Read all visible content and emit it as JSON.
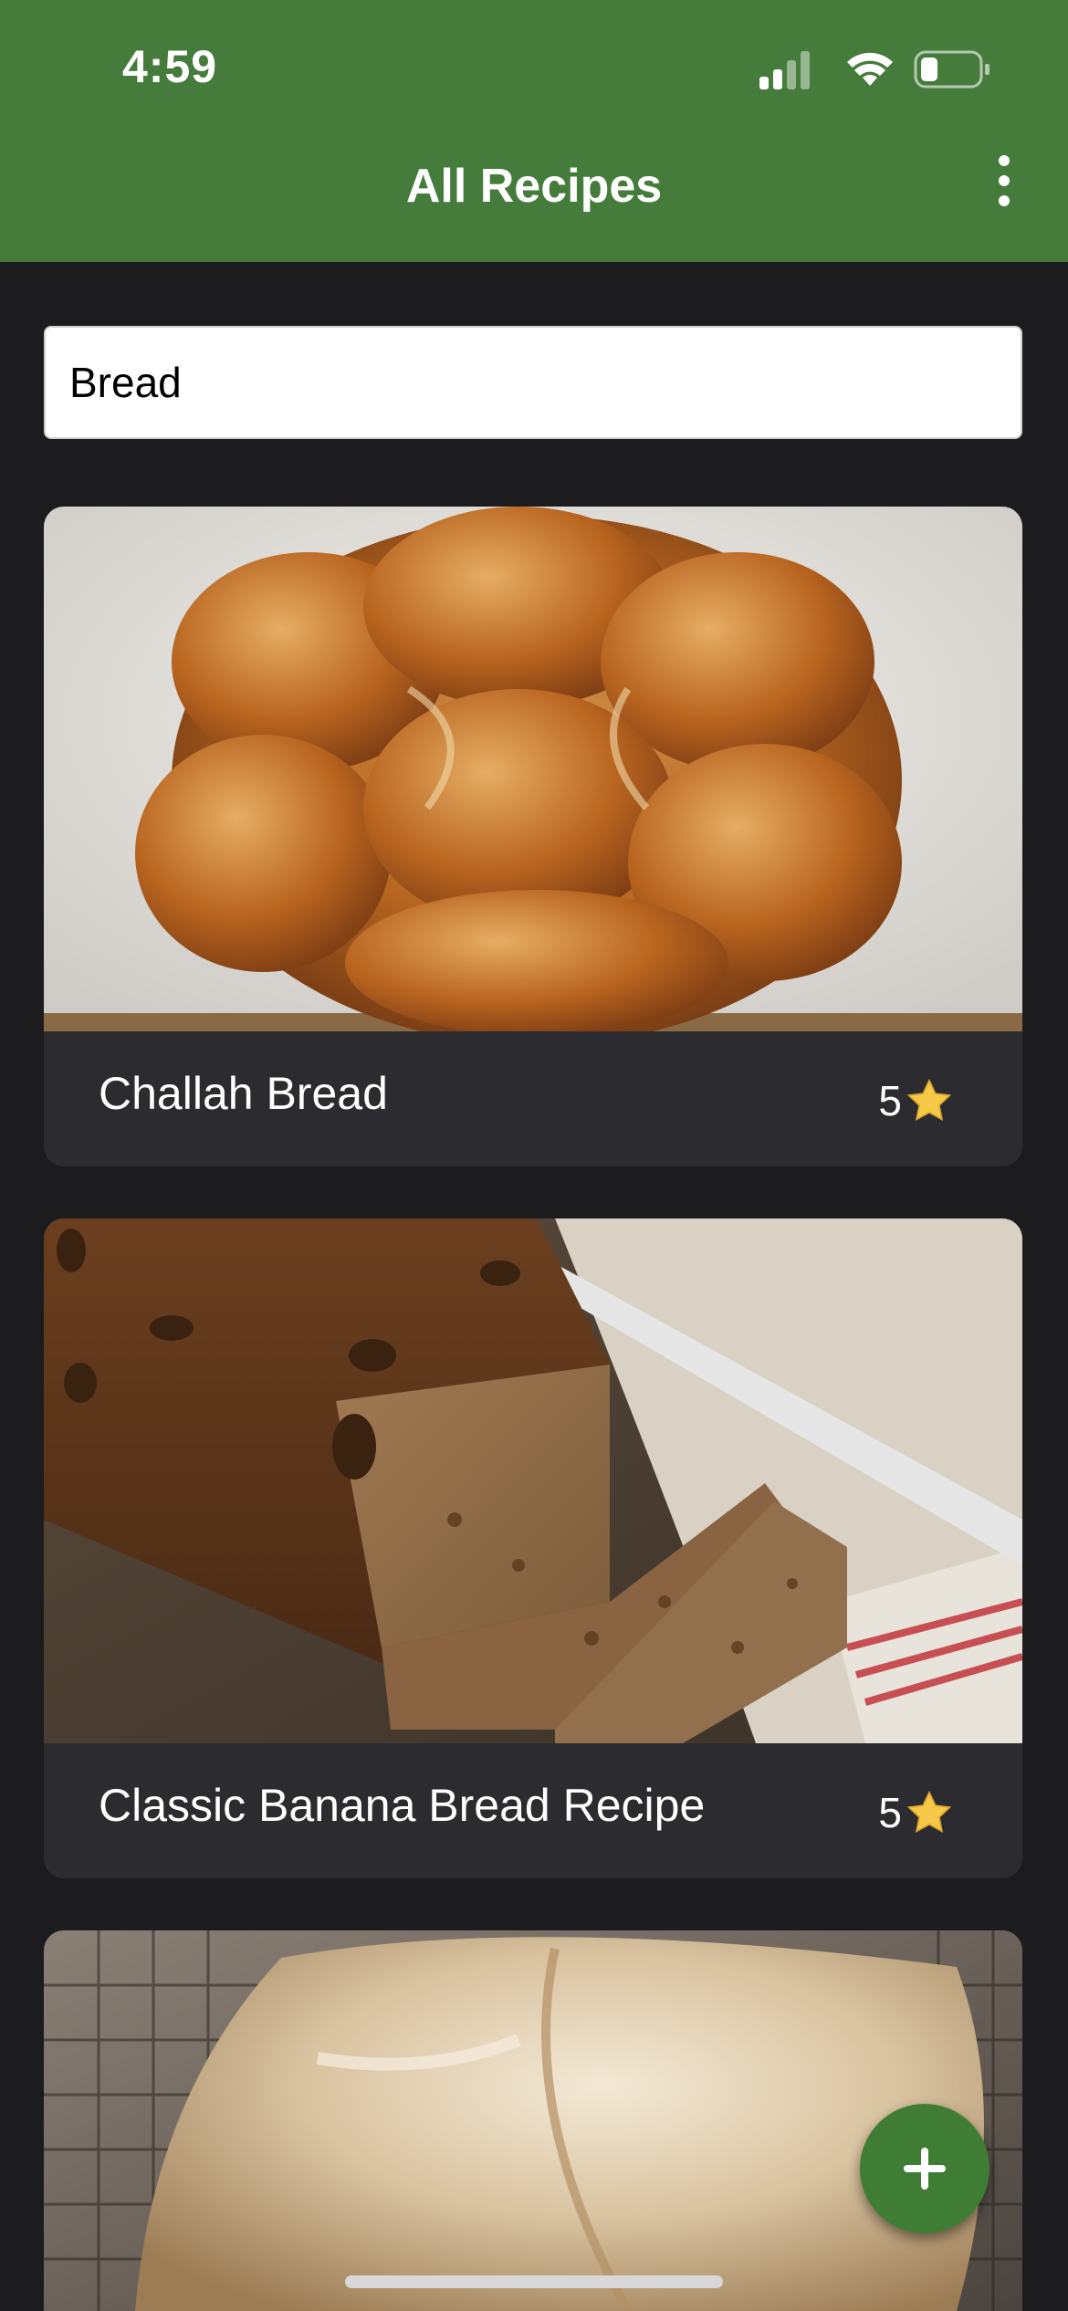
{
  "status_bar": {
    "time": "4:59"
  },
  "header": {
    "title": "All Recipes",
    "background_color": "#457b3b"
  },
  "search": {
    "value": "Bread"
  },
  "recipes": [
    {
      "title": "Challah Bread",
      "rating": "5",
      "image": "challah-bread-photo"
    },
    {
      "title": "Classic Banana Bread Recipe",
      "rating": "5",
      "image": "banana-bread-photo"
    },
    {
      "title": "",
      "rating": "",
      "image": "rustic-bread-loaf-photo"
    }
  ],
  "fab": {
    "icon": "plus-icon",
    "color": "#3f7d35"
  }
}
